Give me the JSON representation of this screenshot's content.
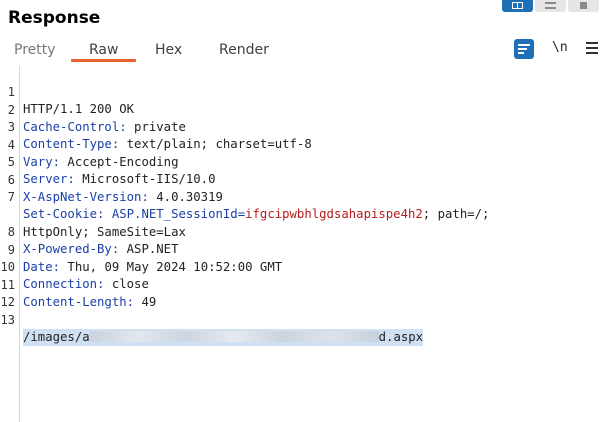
{
  "header": {
    "title": "Response"
  },
  "layout_buttons": [
    {
      "name": "layout-split-horizontal-icon",
      "active": true
    },
    {
      "name": "layout-split-vertical-icon",
      "active": false
    },
    {
      "name": "layout-single-icon",
      "active": false
    }
  ],
  "tabs": [
    {
      "label": "Pretty",
      "active": false
    },
    {
      "label": "Raw",
      "active": true
    },
    {
      "label": "Hex",
      "active": false
    },
    {
      "label": "Render",
      "active": false
    }
  ],
  "toolbar": {
    "newline_label": "\\n"
  },
  "colors": {
    "accent": "#1f6fb8",
    "tab_underline": "#e8602c",
    "header_key": "#1a3fa8",
    "cookie_value": "#b71c1c",
    "selection": "#cfe0f3"
  },
  "lines": [
    {
      "n": "1",
      "text": "HTTP/1.1 200 OK"
    },
    {
      "n": "2",
      "key": "Cache-Control:",
      "value": " private"
    },
    {
      "n": "3",
      "key": "Content-Type:",
      "value": " text/plain; charset=utf-8"
    },
    {
      "n": "4",
      "key": "Vary:",
      "value": " Accept-Encoding"
    },
    {
      "n": "5",
      "key": "Server:",
      "value": " Microsoft-IIS/10.0"
    },
    {
      "n": "6",
      "key": "X-AspNet-Version:",
      "value": " 4.0.30319"
    },
    {
      "n": "7",
      "key": "Set-Cookie:",
      "value_pre": " ASP.NET_SessionId=",
      "cookie_value": "ifgcipwbhlgdsahapispe4h2",
      "value_post": "; path=/;"
    },
    {
      "n": "",
      "text": "HttpOnly; SameSite=Lax"
    },
    {
      "n": "8",
      "key": "X-Powered-By:",
      "value": " ASP.NET"
    },
    {
      "n": "9",
      "key": "Date:",
      "value": " Thu, 09 May 2024 10:52:00 GMT"
    },
    {
      "n": "10",
      "key": "Connection:",
      "value": " close"
    },
    {
      "n": "11",
      "key": "Content-Length:",
      "value": " 49"
    },
    {
      "n": "12",
      "text": ""
    },
    {
      "n": "13",
      "body_pre": "/images/a",
      "body_post": "d.aspx"
    }
  ]
}
